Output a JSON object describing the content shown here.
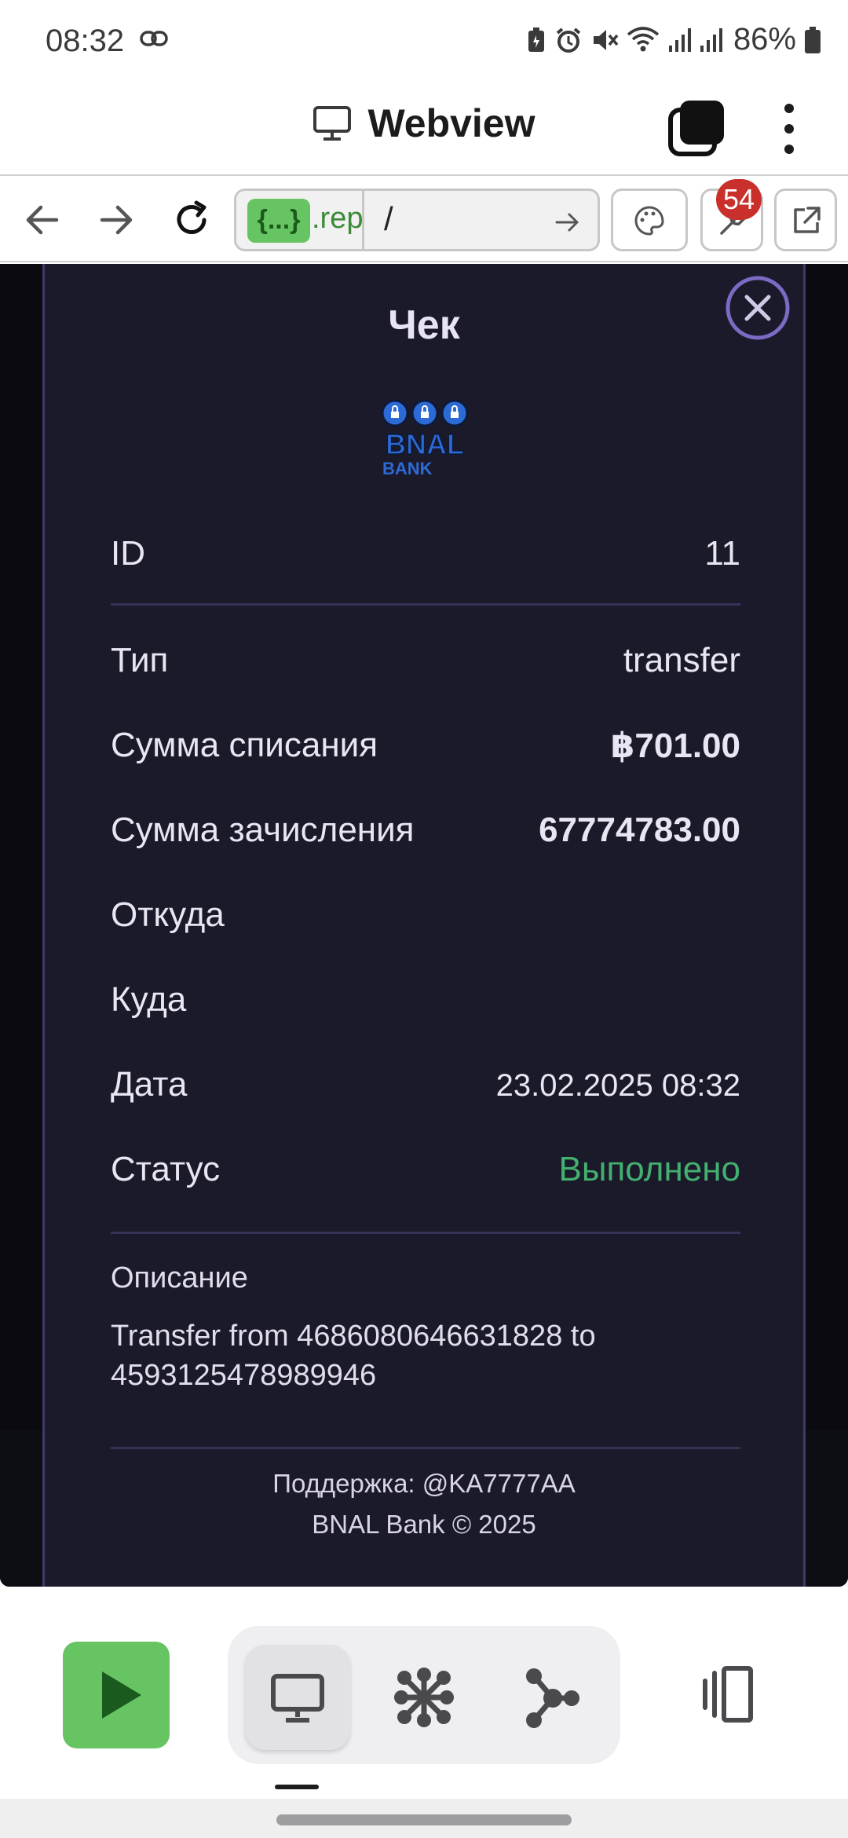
{
  "status_bar": {
    "time": "08:32",
    "battery_percent": "86%",
    "icons": [
      "link-icon",
      "battery-saver-icon",
      "alarm-icon",
      "mute-icon",
      "wifi-icon",
      "signal-icon",
      "signal-icon",
      "battery-icon"
    ]
  },
  "app_bar": {
    "title": "Webview",
    "icons": [
      "monitor-icon",
      "tabs-icon",
      "more-vert-icon"
    ]
  },
  "url_bar": {
    "badge": "{...}",
    "domain": ".rep",
    "path": "/",
    "notification_count": "54",
    "icons": [
      "back-arrow-icon",
      "forward-arrow-icon",
      "reload-icon",
      "go-arrow-icon",
      "palette-icon",
      "wrench-icon",
      "open-external-icon"
    ]
  },
  "receipt": {
    "title": "Чек",
    "logo_text": "BNAL BANK",
    "fields": {
      "id": {
        "label": "ID",
        "value": "11"
      },
      "type": {
        "label": "Тип",
        "value": "transfer"
      },
      "debit": {
        "label": "Сумма списания",
        "value": "฿701.00"
      },
      "credit": {
        "label": "Сумма зачисления",
        "value": "67774783.00"
      },
      "from": {
        "label": "Откуда",
        "value": ""
      },
      "to": {
        "label": "Куда",
        "value": ""
      },
      "date": {
        "label": "Дата",
        "value": "23.02.2025 08:32"
      },
      "status": {
        "label": "Статус",
        "value": "Выполнено"
      }
    },
    "description_label": "Описание",
    "description": "Transfer from 4686080646631828 to 4593125478989946",
    "support": "Поддержка: @KA7777AA",
    "copyright": "BNAL Bank © 2025",
    "colors": {
      "background": "#1b1a2a",
      "status_success": "#43b070",
      "accent": "#7b6bc4"
    }
  },
  "bottom_toolbar": {
    "icons": [
      "play-icon",
      "monitor-icon",
      "network-grid-icon",
      "graph-node-icon",
      "screen-rotate-icon"
    ],
    "active_item": "monitor-icon",
    "accent": "#66c462"
  }
}
